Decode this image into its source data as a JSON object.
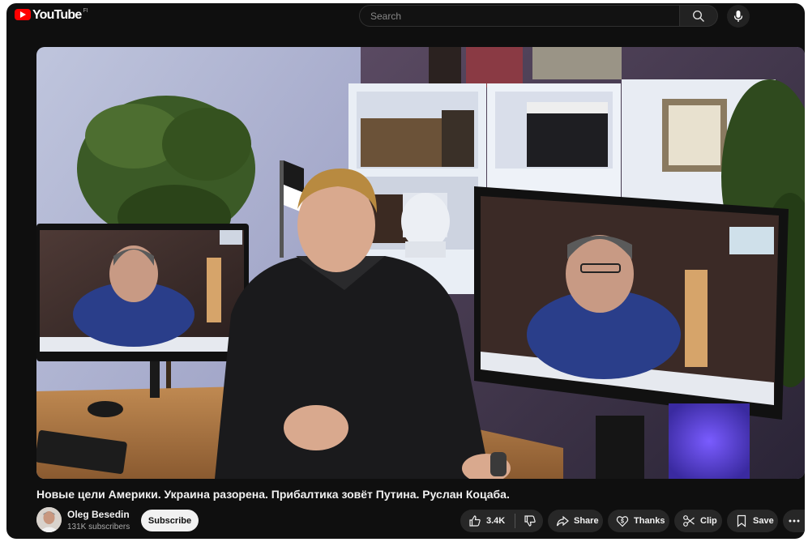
{
  "header": {
    "logo_text": "YouTube",
    "country_code": "FI",
    "search_placeholder": "Search"
  },
  "video": {
    "title": "Новые цели Америки. Украина разорена. Прибалтика зовёт Путина. Руслан Коцаба."
  },
  "channel": {
    "name": "Oleg Besedin",
    "subscribers": "131K subscribers",
    "subscribe_label": "Subscribe"
  },
  "actions": {
    "like_count": "3.4K",
    "share_label": "Share",
    "thanks_label": "Thanks",
    "clip_label": "Clip",
    "save_label": "Save"
  },
  "colors": {
    "brand_red": "#ff0000",
    "background": "#0f0f0f",
    "pill": "#272727"
  }
}
